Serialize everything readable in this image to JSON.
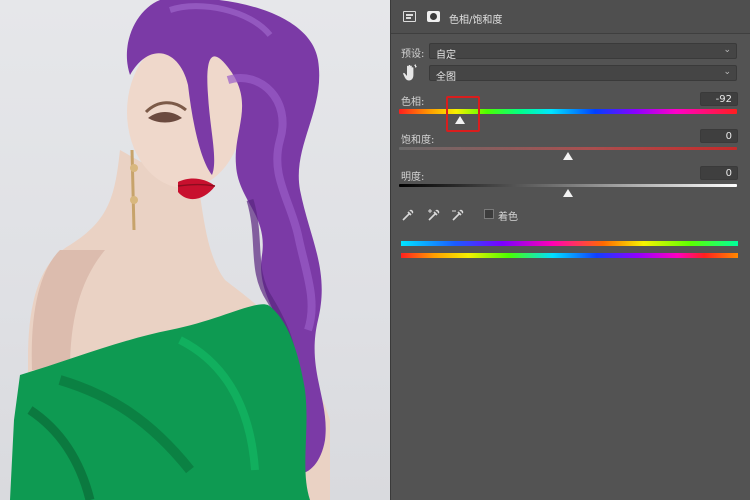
{
  "panel": {
    "title": "色相/饱和度",
    "preset_label": "预设:",
    "preset_value": "自定",
    "channel_value": "全图"
  },
  "sliders": {
    "hue": {
      "label": "色相:",
      "value": "-92",
      "fraction": 0.18
    },
    "saturation": {
      "label": "饱和度:",
      "value": "0",
      "fraction": 0.5
    },
    "lightness": {
      "label": "明度:",
      "value": "0",
      "fraction": 0.5
    }
  },
  "colorize": {
    "label": "着色",
    "checked": false
  },
  "colors": {
    "panel_bg": "#535353",
    "highlight": "#d91d1d",
    "hair": "#7b3aa6",
    "dress": "#0e9a52",
    "lips": "#c8102e"
  },
  "icons": [
    "adjustment-layer-icon",
    "layer-mask-icon",
    "target-hand-icon",
    "eyedropper-icon",
    "eyedropper-plus-icon",
    "eyedropper-minus-icon",
    "chevron-down-icon"
  ]
}
